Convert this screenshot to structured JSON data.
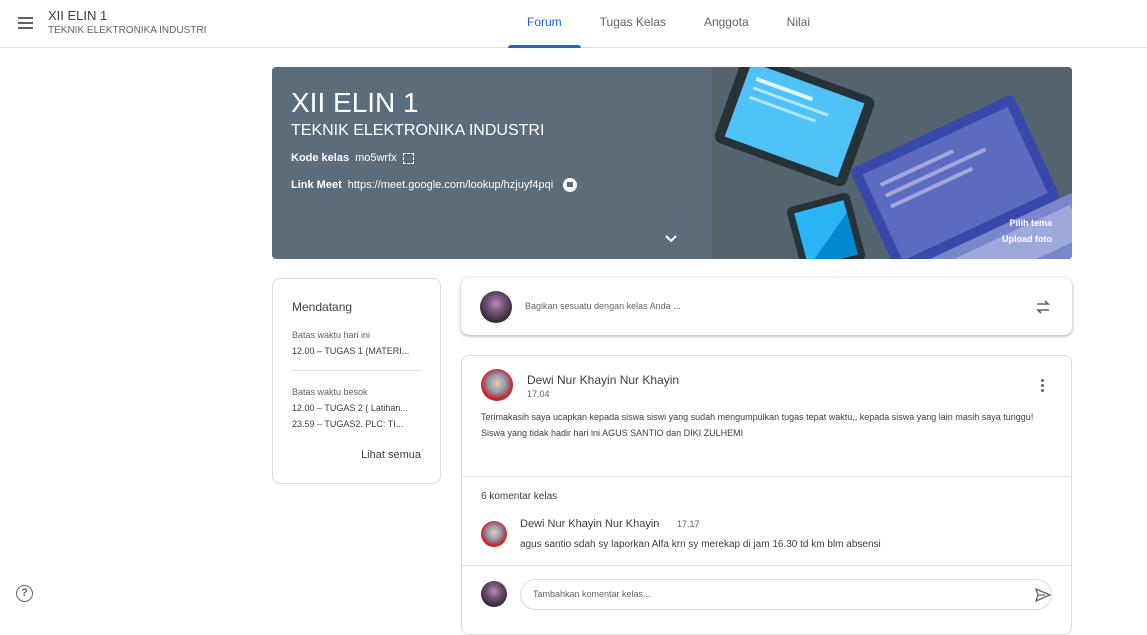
{
  "header": {
    "class_name": "XII ELIN 1",
    "class_section": "TEKNIK ELEKTRONIKA INDUSTRI",
    "menu_icon": "hamburger-menu-icon",
    "tabs": [
      {
        "label": "Forum",
        "active": true
      },
      {
        "label": "Tugas Kelas",
        "active": false
      },
      {
        "label": "Anggota",
        "active": false
      },
      {
        "label": "Nilai",
        "active": false
      }
    ],
    "accent_color": "#1967d2"
  },
  "banner": {
    "title": "XII ELIN 1",
    "subtitle": "TEKNIK ELEKTRONIKA INDUSTRI",
    "code_label": "Kode kelas",
    "code_value": "mo5wrfx",
    "meet_label": "Link Meet",
    "meet_url": "https://meet.google.com/lookup/hzjuyf4pqi",
    "choose_theme": "Pilih tema",
    "upload_photo": "Upload foto",
    "background_color": "#5b6c7a"
  },
  "upcoming": {
    "title": "Mendatang",
    "groups": [
      {
        "label": "Batas waktu hari ini",
        "items": [
          "12.00 – TUGAS 1 (MATERI..."
        ]
      },
      {
        "label": "Batas waktu besok",
        "items": [
          "12.00 – TUGAS 2 ( Latihan...",
          "23.59 – TUGAS2. PLC: TI..."
        ]
      }
    ],
    "see_all": "Lihat semua"
  },
  "share": {
    "placeholder": "Bagikan sesuatu dengan kelas Anda ..."
  },
  "post": {
    "author": "Dewi Nur Khayin Nur Khayin",
    "time": "17.04",
    "body_line1": "Terimakasih saya ucapkan kepada siswa siswi yang sudah mengumpulkan tugas tepat waktu,, kepada siswa yang lain masih saya tunggu!",
    "body_line2": "Siswa yang tidak hadir hari ini AGUS SANTIO dan DIKI ZULHEMI",
    "comments_count": "6 komentar kelas",
    "comment": {
      "author": "Dewi Nur Khayin Nur Khayin",
      "time": "17.17",
      "text": "agus santio sdah sy laporkan Alfa krn sy merekap di jam 16.30 td km blm absensi"
    },
    "add_comment_placeholder": "Tambahkan komentar kelas..."
  },
  "help": {
    "label": "?"
  }
}
